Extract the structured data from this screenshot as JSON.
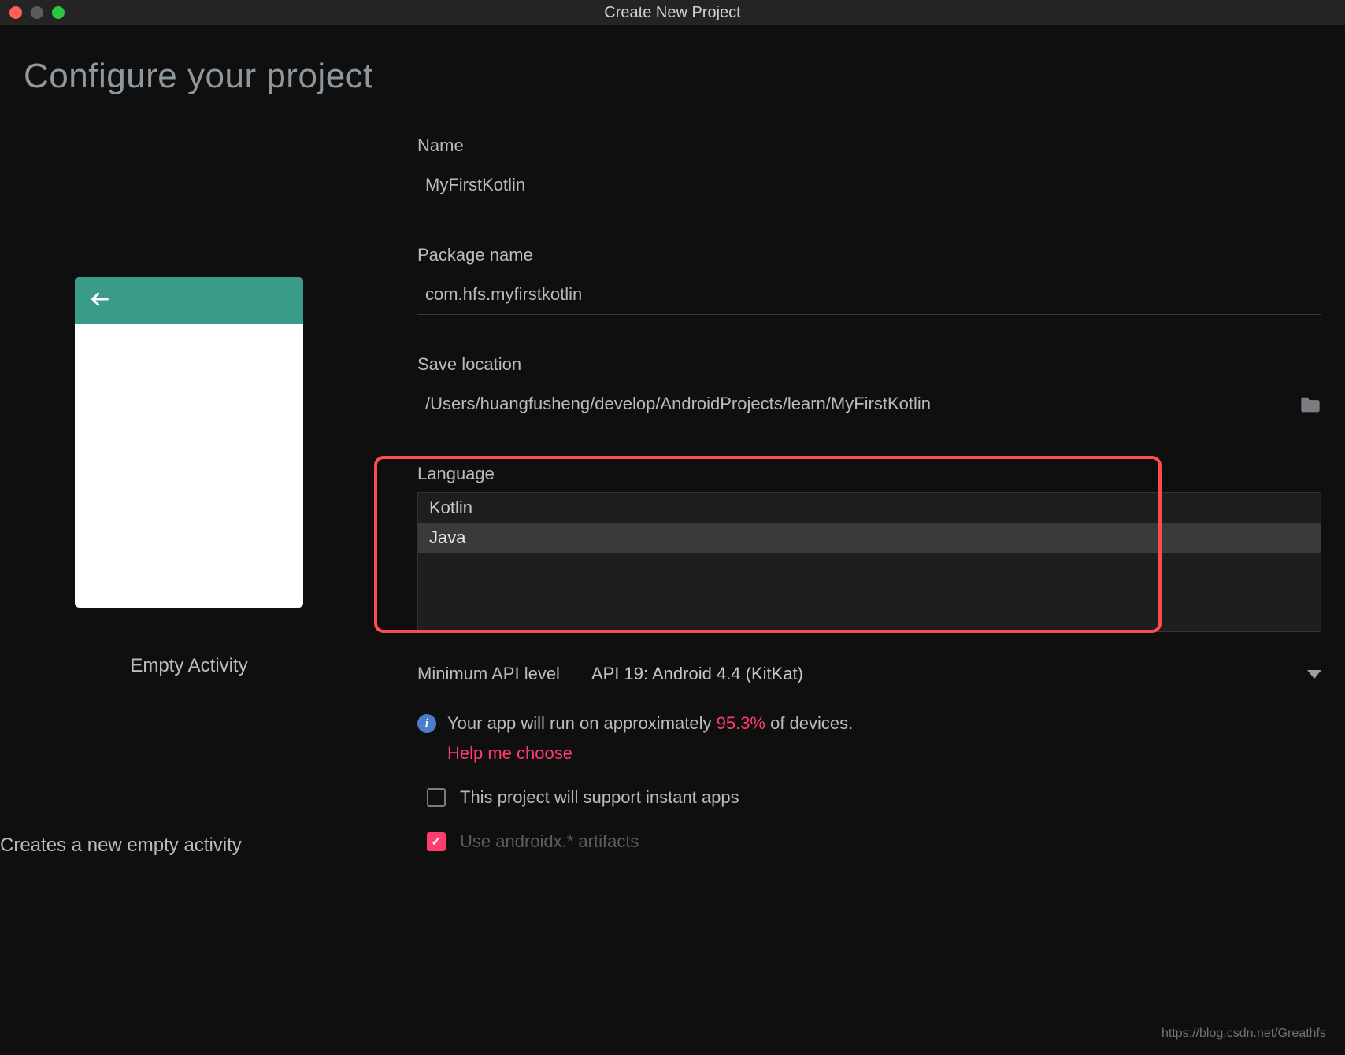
{
  "window": {
    "title": "Create New Project"
  },
  "page": {
    "heading": "Configure your project"
  },
  "preview": {
    "label": "Empty Activity",
    "description": "Creates a new empty activity"
  },
  "form": {
    "name_label": "Name",
    "name_value": "MyFirstKotlin",
    "package_label": "Package name",
    "package_value": "com.hfs.myfirstkotlin",
    "location_label": "Save location",
    "location_value": "/Users/huangfusheng/develop/AndroidProjects/learn/MyFirstKotlin",
    "language_label": "Language",
    "language_options": [
      "Kotlin",
      "Java"
    ],
    "api_label": "Minimum API level",
    "api_value": "API 19: Android 4.4 (KitKat)",
    "info_prefix": "Your app will run on approximately ",
    "info_percent": "95.3%",
    "info_suffix": " of devices.",
    "help_link": "Help me choose",
    "instant_apps_label": "This project will support instant apps",
    "androidx_label": "Use androidx.* artifacts"
  },
  "watermark": "https://blog.csdn.net/Greathfs"
}
